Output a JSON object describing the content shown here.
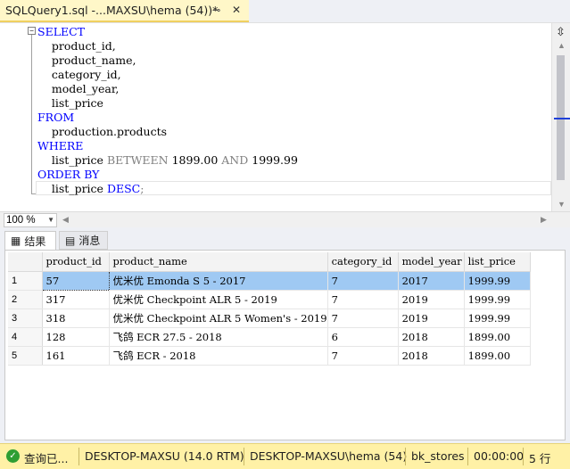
{
  "tab": {
    "title": "SQLQuery1.sql -...MAXSU\\hema (54))*",
    "pin_icon": "pin-icon",
    "close_label": "✕"
  },
  "editor": {
    "fold_symbol": "−",
    "lines": [
      [
        {
          "t": "SELECT",
          "c": "kw"
        }
      ],
      [
        {
          "t": "    product_id,",
          "c": ""
        }
      ],
      [
        {
          "t": "    product_name,",
          "c": ""
        }
      ],
      [
        {
          "t": "    category_id,",
          "c": ""
        }
      ],
      [
        {
          "t": "    model_year,",
          "c": ""
        }
      ],
      [
        {
          "t": "    list_price",
          "c": ""
        }
      ],
      [
        {
          "t": "FROM",
          "c": "kw"
        }
      ],
      [
        {
          "t": "    production.products",
          "c": ""
        }
      ],
      [
        {
          "t": "WHERE",
          "c": "kw"
        }
      ],
      [
        {
          "t": "    list_price ",
          "c": ""
        },
        {
          "t": "BETWEEN",
          "c": "gr"
        },
        {
          "t": " 1899.00 ",
          "c": ""
        },
        {
          "t": "AND",
          "c": "gr"
        },
        {
          "t": " 1999.99",
          "c": ""
        }
      ],
      [
        {
          "t": "ORDER BY",
          "c": "kw"
        }
      ],
      [
        {
          "t": "    list_price ",
          "c": ""
        },
        {
          "t": "DESC",
          "c": "kw"
        },
        {
          "t": ";",
          "c": "gr"
        }
      ]
    ]
  },
  "zoom": {
    "value": "100 %"
  },
  "results": {
    "tabs": [
      {
        "label": "结果",
        "icon": "grid-icon"
      },
      {
        "label": "消息",
        "icon": "message-icon"
      }
    ],
    "columns": [
      "product_id",
      "product_name",
      "category_id",
      "model_year",
      "list_price"
    ],
    "rows": [
      {
        "n": "1",
        "cells": [
          "57",
          "优米优 Emonda S 5 - 2017",
          "7",
          "2017",
          "1999.99"
        ]
      },
      {
        "n": "2",
        "cells": [
          "317",
          "优米优 Checkpoint ALR 5 - 2019",
          "7",
          "2019",
          "1999.99"
        ]
      },
      {
        "n": "3",
        "cells": [
          "318",
          "优米优 Checkpoint ALR 5 Women's - 2019",
          "7",
          "2019",
          "1999.99"
        ]
      },
      {
        "n": "4",
        "cells": [
          "128",
          "飞鸽 ECR 27.5 - 2018",
          "6",
          "2018",
          "1899.00"
        ]
      },
      {
        "n": "5",
        "cells": [
          "161",
          "飞鸽 ECR - 2018",
          "7",
          "2018",
          "1899.00"
        ]
      }
    ]
  },
  "status": {
    "state": "查询已...",
    "server": "DESKTOP-MAXSU (14.0 RTM)",
    "user": "DESKTOP-MAXSU\\hema (54)",
    "database": "bk_stores",
    "elapsed": "00:00:00",
    "rows": "5 行"
  }
}
